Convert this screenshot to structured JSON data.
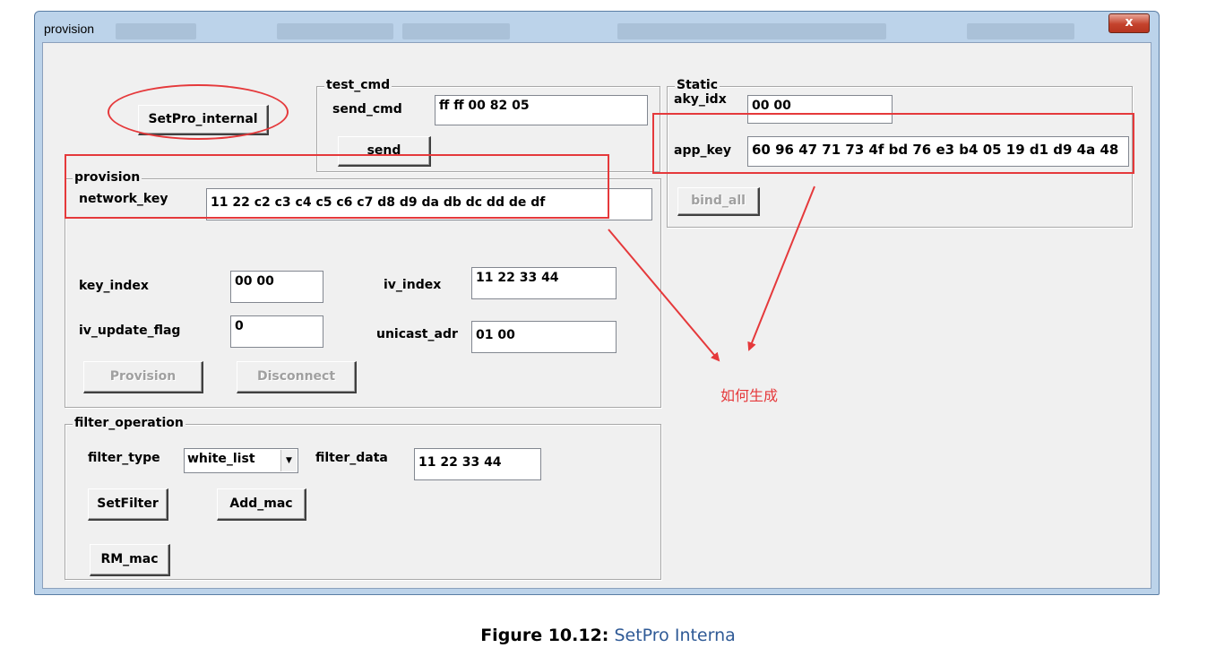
{
  "window": {
    "title": "provision",
    "close_glyph": "x"
  },
  "top_buttons": {
    "setpro_internal": "SetPro_internal"
  },
  "test_cmd": {
    "legend": "test_cmd",
    "send_cmd_label": "send_cmd",
    "send_cmd_value": "ff ff 00 82 05",
    "send_button": "send"
  },
  "static": {
    "legend": "Static",
    "aky_idx_label": "aky_idx",
    "aky_idx_value": "00 00",
    "app_key_label": "app_key",
    "app_key_value": "60 96 47 71 73 4f bd 76 e3 b4 05 19 d1 d9 4a 48",
    "bind_all_button": "bind_all"
  },
  "provision": {
    "legend": "provision",
    "network_key_label": "network_key",
    "network_key_value": "11 22 c2 c3 c4 c5 c6 c7 d8 d9 da db dc dd de df",
    "key_index_label": "key_index",
    "key_index_value": "00 00",
    "iv_index_label": "iv_index",
    "iv_index_value": "11 22 33 44",
    "iv_update_flag_label": "iv_update_flag",
    "iv_update_flag_value": "0",
    "unicast_adr_label": "unicast_adr",
    "unicast_adr_value": "01 00",
    "provision_button": "Provision",
    "disconnect_button": "Disconnect"
  },
  "filter_operation": {
    "legend": "filter_operation",
    "filter_type_label": "filter_type",
    "filter_type_selected": "white_list",
    "filter_data_label": "filter_data",
    "filter_data_value": "11 22 33 44",
    "setfilter_button": "SetFilter",
    "add_mac_button": "Add_mac",
    "rm_mac_button": "RM_mac"
  },
  "annotation": {
    "note": "如何生成",
    "color": "#e5393b"
  },
  "caption": {
    "label": "Figure 10.12",
    "separator": ":",
    "text": "SetPro Interna"
  }
}
